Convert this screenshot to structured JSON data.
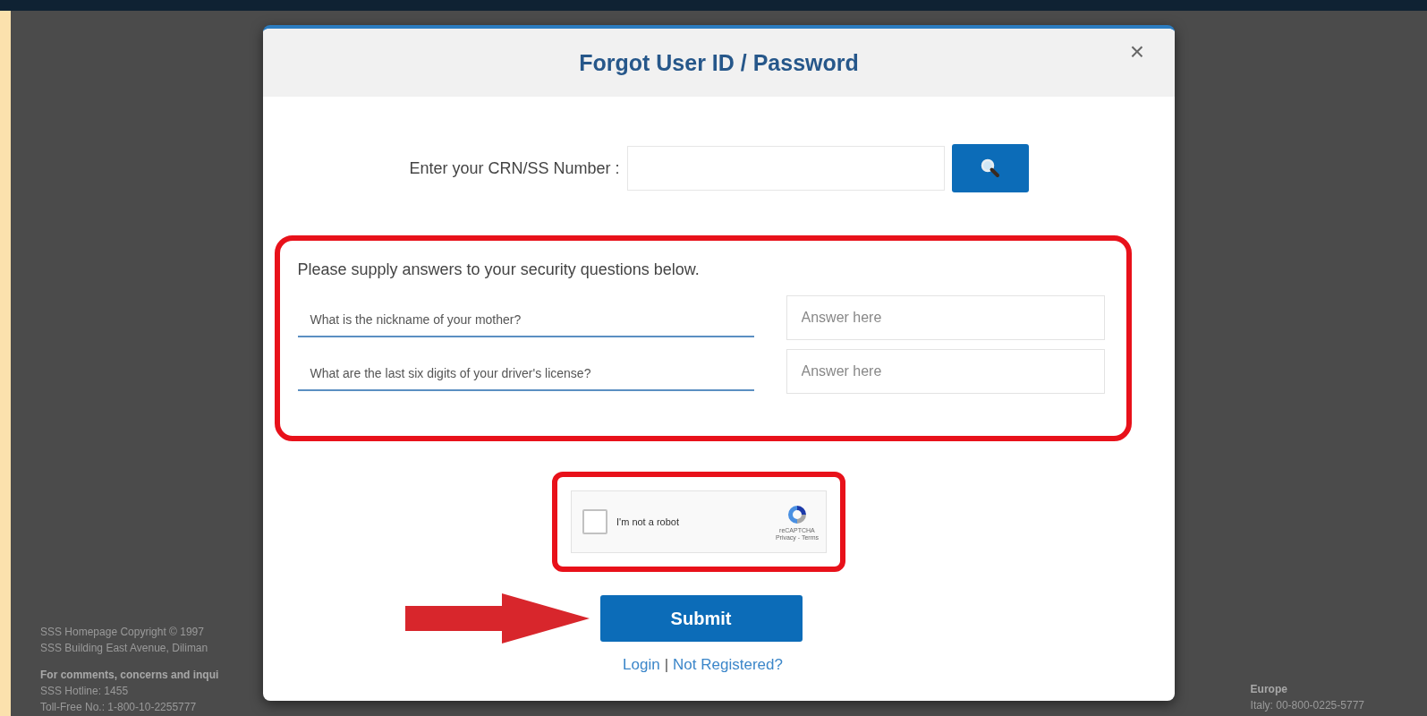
{
  "background_footer": {
    "left": [
      "SSS Homepage Copyright © 1997",
      "SSS Building East Avenue, Diliman"
    ],
    "contact_heading": "For comments, concerns and inqui",
    "contact_lines": [
      "SSS Hotline: 1455",
      "Toll-Free No.: 1-800-10-2255777"
    ],
    "right_heading": "Europe",
    "right_lines": [
      "Italy: 00-800-0225-5777"
    ]
  },
  "modal": {
    "title": "Forgot User ID / Password",
    "close": "×",
    "crn": {
      "label": "Enter your CRN/SS Number :"
    },
    "security": {
      "intro": "Please supply answers to your security questions below.",
      "highlighted": true,
      "questions": [
        {
          "question": "What is the nickname of your mother?",
          "placeholder": "Answer here"
        },
        {
          "question": "What are the last six digits of your driver's license?",
          "placeholder": "Answer here"
        }
      ]
    },
    "captcha": {
      "label": "I'm not a robot",
      "checked": false,
      "highlighted": true,
      "brand": "reCAPTCHA",
      "links": "Privacy - Terms"
    },
    "submit": "Submit",
    "submit_pointed": true,
    "links": [
      {
        "label": "Login"
      },
      {
        "label": "Not Registered?"
      }
    ],
    "link_separator": "|"
  }
}
